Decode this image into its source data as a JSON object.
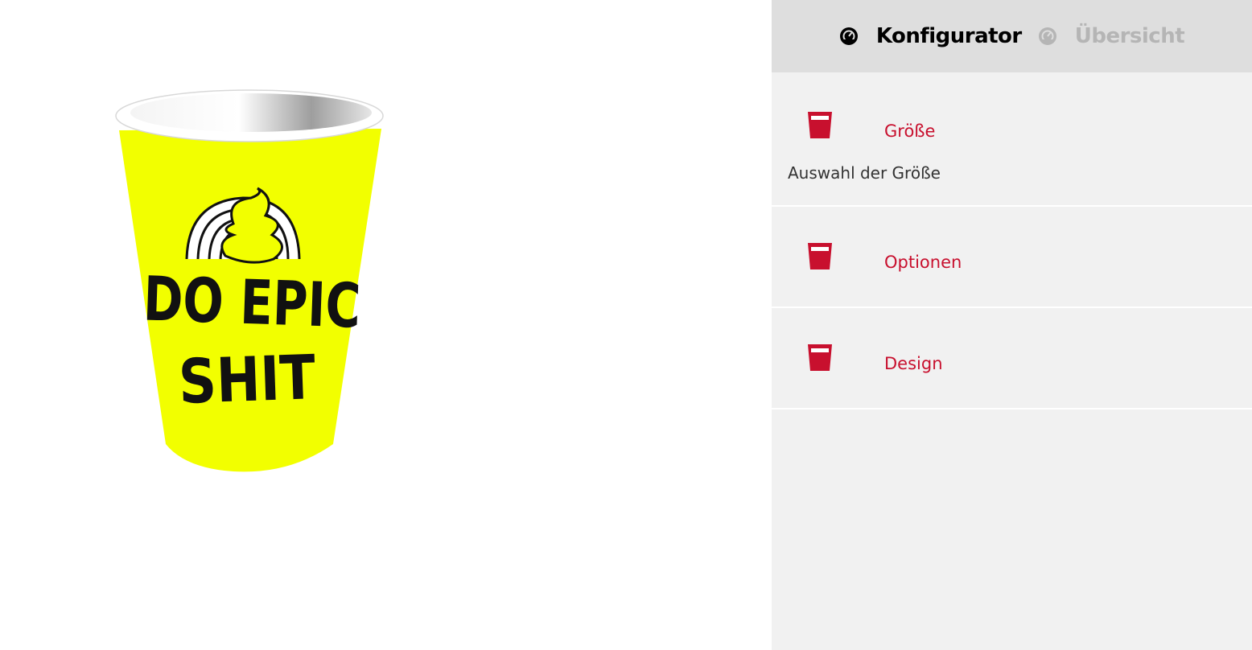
{
  "tabs": [
    {
      "label": "Konfigurator",
      "state": "active",
      "icon": "speedometer-icon"
    },
    {
      "label": "Übersicht",
      "state": "inactive",
      "icon": "speedometer-icon"
    }
  ],
  "sections": [
    {
      "label": "Größe",
      "description": "Auswahl der Größe",
      "icon": "cup-icon"
    },
    {
      "label": "Optionen",
      "icon": "cup-icon"
    },
    {
      "label": "Design",
      "icon": "cup-icon"
    }
  ],
  "cup": {
    "line1": "DO EPIC",
    "line2": "SHIT",
    "body_color": "#f2ff00"
  },
  "colors": {
    "accent": "#c8102e",
    "panel_bg": "#f1f1f1",
    "tabbar_bg": "#dedede"
  }
}
